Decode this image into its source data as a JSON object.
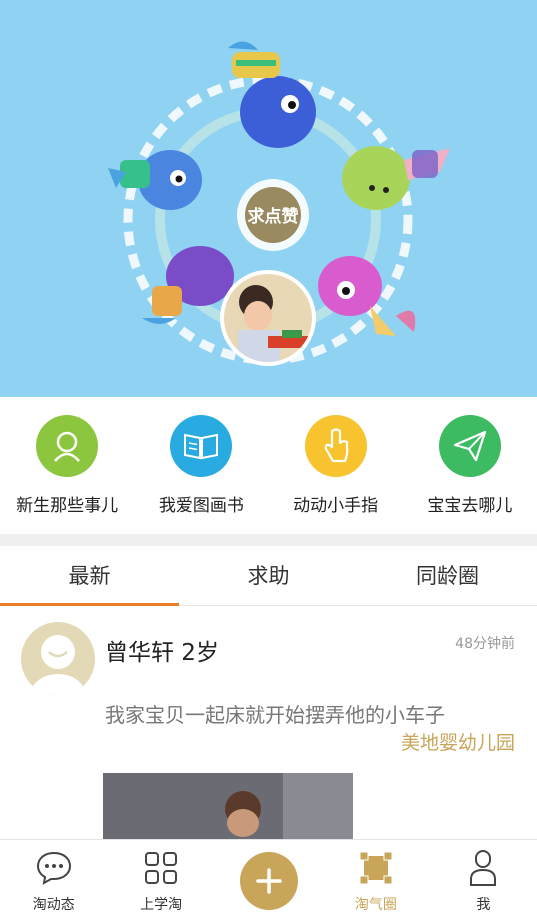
{
  "banner": {
    "center_badge": "求点赞"
  },
  "categories": [
    {
      "label": "新生那些事儿",
      "icon": "baby-face-icon",
      "color": "#8cc63f"
    },
    {
      "label": "我爱图画书",
      "icon": "open-book-icon",
      "color": "#29abe2"
    },
    {
      "label": "动动小手指",
      "icon": "finger-icon",
      "color": "#f7c32e"
    },
    {
      "label": "宝宝去哪儿",
      "icon": "paper-plane-icon",
      "color": "#3dbb63"
    }
  ],
  "tabs": [
    {
      "label": "最新",
      "active": true
    },
    {
      "label": "求助",
      "active": false
    },
    {
      "label": "同龄圈",
      "active": false
    }
  ],
  "post": {
    "author": "曾华轩 2岁",
    "time": "48分钟前",
    "content": "我家宝贝一起床就开始摆弄他的小车子",
    "school": "美地婴幼儿园"
  },
  "nav": [
    {
      "label": "淘动态",
      "icon": "chat-bubble-icon",
      "active": false
    },
    {
      "label": "上学淘",
      "icon": "grid-icon",
      "active": false
    },
    {
      "label": "",
      "icon": "plus-icon",
      "active": false
    },
    {
      "label": "淘气圈",
      "icon": "square-frame-icon",
      "active": true
    },
    {
      "label": "我",
      "icon": "person-icon",
      "active": false
    }
  ],
  "colors": {
    "accent_orange": "#ee7d2a",
    "gold": "#c9a55a",
    "banner_bg": "#8fd2f2"
  }
}
